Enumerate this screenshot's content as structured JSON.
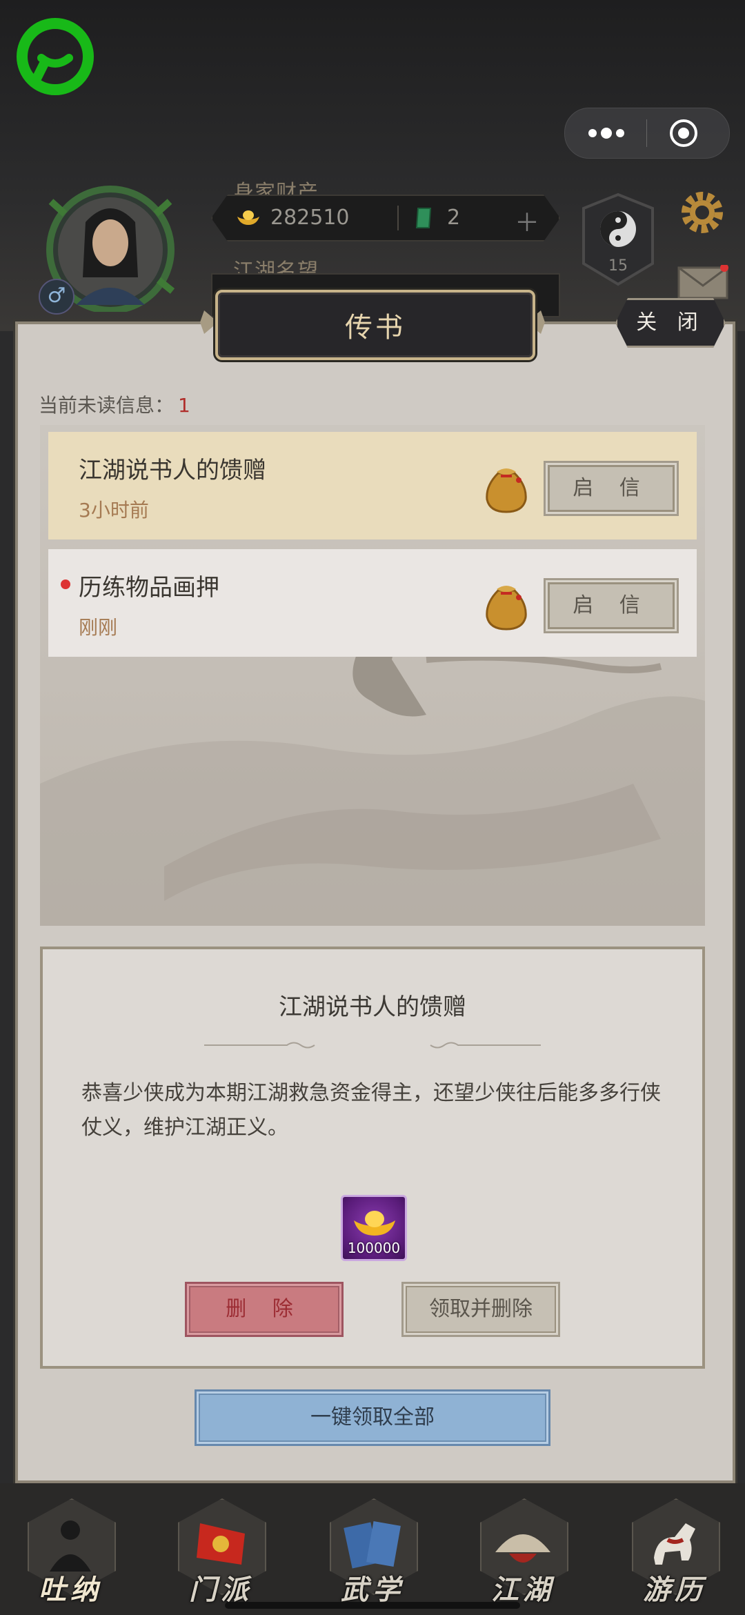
{
  "hud": {
    "wealth_label": "身家财产",
    "gold_amount": "282510",
    "jade_amount": "2",
    "fame_label": "江湖名望",
    "rank_level": "15"
  },
  "dialog": {
    "title": "传书",
    "close_label": "关 闭",
    "unread_label": "当前未读信息：",
    "unread_count": "1",
    "mails": [
      {
        "title": "江湖说书人的馈赠",
        "time": "3小时前",
        "button": "启 信",
        "unread": false,
        "selected": true
      },
      {
        "title": "历练物品画押",
        "time": "刚刚",
        "button": "启 信",
        "unread": true,
        "selected": false
      }
    ],
    "detail": {
      "title": "江湖说书人的馈赠",
      "body": "恭喜少侠成为本期江湖救急资金得主，还望少侠往后能多多行侠仗义，维护江湖正义。",
      "reward_qty": "100000",
      "reward_icon": "gold-ingot-icon",
      "delete_label": "删 除",
      "claim_delete_label": "领取并删除"
    },
    "claim_all_label": "一键领取全部"
  },
  "nav": [
    {
      "label": "吐纳",
      "icon": "meditation-icon"
    },
    {
      "label": "门派",
      "icon": "sect-banner-icon"
    },
    {
      "label": "武学",
      "icon": "martial-book-icon"
    },
    {
      "label": "江湖",
      "icon": "bamboo-hat-icon"
    },
    {
      "label": "游历",
      "icon": "horse-icon"
    }
  ],
  "colors": {
    "accent_red": "#b02d2a",
    "selected_row": "#e9dcbc",
    "delete_button": "#c97b80",
    "claim_all_button": "#8fb2d4"
  }
}
